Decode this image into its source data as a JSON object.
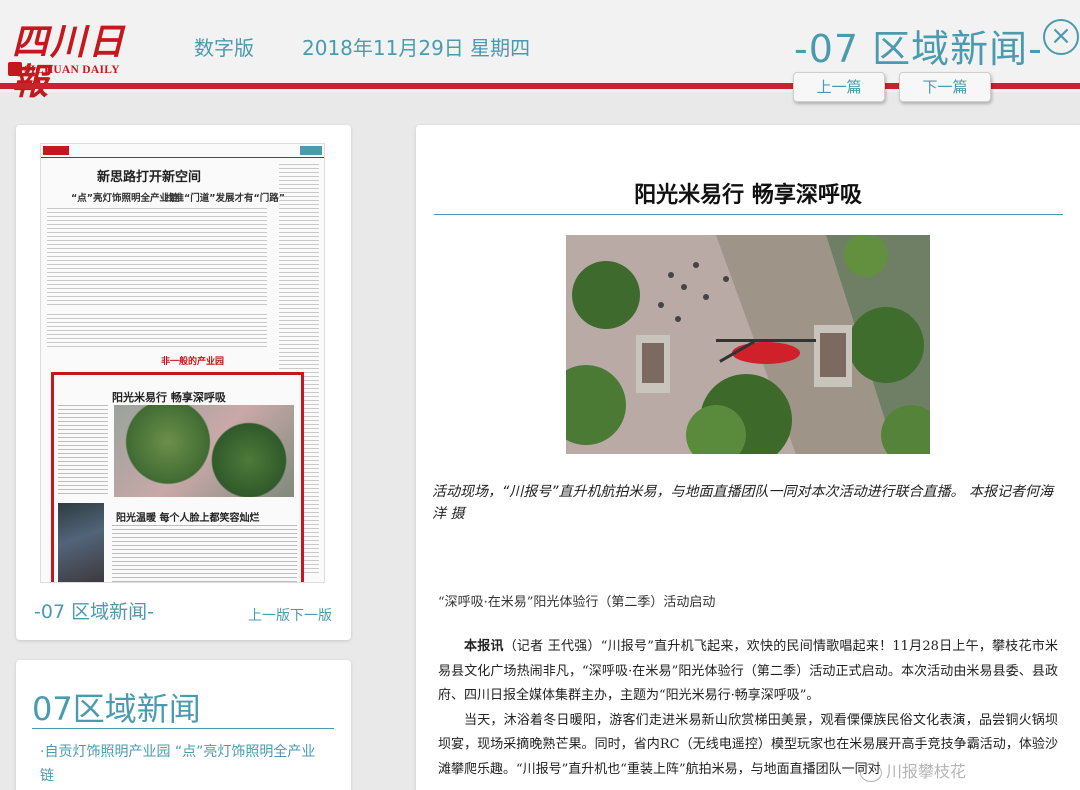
{
  "header": {
    "logo_cn": "四川日報",
    "logo_en": "SICHUAN DAILY",
    "edition": "数字版",
    "date": "2018年11月29日 星期四",
    "section_title": "-07 区域新闻-",
    "close_glyph": "×",
    "prev_label": "上一篇",
    "next_label": "下一篇"
  },
  "thumbnail": {
    "page_headline": "新思路打开新空间",
    "page_sub1": "“点”亮灯饰照明全产业链",
    "page_sub2": "找准“门道”发展才有“门路”",
    "band_text": "非一般的产业园",
    "highlight_headline": "阳光米易行  畅享深呼吸",
    "highlight_sub": "阳光温暖  每个人脸上都笑容灿烂",
    "page_label": "-07 区域新闻-",
    "nav_label": "上一版下一版"
  },
  "article_list": {
    "title": "07区域新闻",
    "items": [
      "·自贡灯饰照明产业园 “点”亮灯饰照明全产业链"
    ]
  },
  "article": {
    "title": "阳光米易行 畅享深呼吸",
    "caption": "活动现场，“川报号”直升机航拍米易，与地面直播团队一同对本次活动进行联合直播。 本报记者何海洋 摄",
    "subhead": "“深呼吸·在米易”阳光体验行（第二季）活动启动",
    "lead": "本报讯",
    "paragraph1": "（记者 王代强）“川报号”直升机飞起来，欢快的民间情歌唱起来！11月28日上午，攀枝花市米易县文化广场热闹非凡，“深呼吸·在米易”阳光体验行（第二季）活动正式启动。本次活动由米易县委、县政府、四川日报全媒体集群主办，主题为“阳光米易行·畅享深呼吸”。",
    "paragraph2": "当天，沐浴着冬日暖阳，游客们走进米易新山欣赏梯田美景，观看傈僳族民俗文化表演，品尝铜火锅坝坝宴，现场采摘晚熟芒果。同时，省内RC（无线电遥控）模型玩家也在米易展开高手竞技争霸活动，体验沙滩攀爬乐趣。“川报号”直升机也“重装上阵”航拍米易，与地面直播团队一同对"
  },
  "watermark": "川报攀枝花"
}
